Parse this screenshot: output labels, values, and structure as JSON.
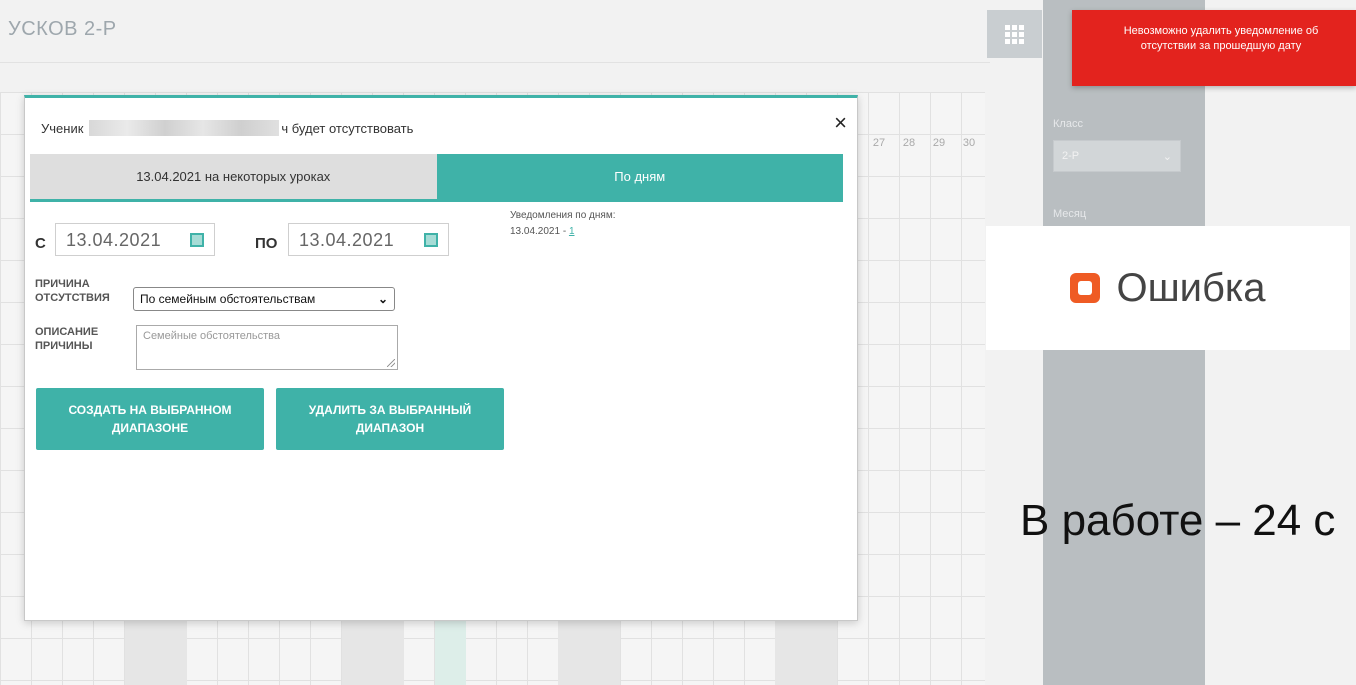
{
  "page": {
    "title": "УСКОВ 2-Р",
    "day_numbers": [
      "27",
      "28",
      "29",
      "30"
    ]
  },
  "side_panel": {
    "class_label": "Класс",
    "class_value": "2-Р",
    "month_label": "Месяц"
  },
  "toast": {
    "message": "Невозможно удалить уведомление об отсутствии за прошедшую дату",
    "color": "#e3231e"
  },
  "error_card": {
    "icon": "error-square-icon",
    "text": "Ошибка",
    "icon_color": "#ef5b24"
  },
  "status_text": "В работе – 24 с",
  "modal": {
    "header_prefix": "Ученик",
    "header_suffix": "ч будет отсутствовать",
    "close_label": "×",
    "tabs": [
      {
        "label": "13.04.2021 на некоторых уроках",
        "active": false
      },
      {
        "label": "По дням",
        "active": true
      }
    ],
    "from_label": "С",
    "from_value": "13.04.2021",
    "to_label": "ПО",
    "to_value": "13.04.2021",
    "notifications_label": "Уведомления по дням:",
    "notification_date": "13.04.2021 - ",
    "notification_link": "1",
    "reason_label": "ПРИЧИНА ОТСУТСТВИЯ",
    "reason_value": "По семейным обстоятельствам",
    "description_label": "ОПИСАНИЕ ПРИЧИНЫ",
    "description_placeholder": "Семейные обстоятельства",
    "create_button": "СОЗДАТЬ НА ВЫБРАННОМ ДИАПАЗОНЕ",
    "delete_button": "УДАЛИТЬ ЗА ВЫБРАННЫЙ ДИАПАЗОН",
    "accent_color": "#3fb2a8"
  }
}
